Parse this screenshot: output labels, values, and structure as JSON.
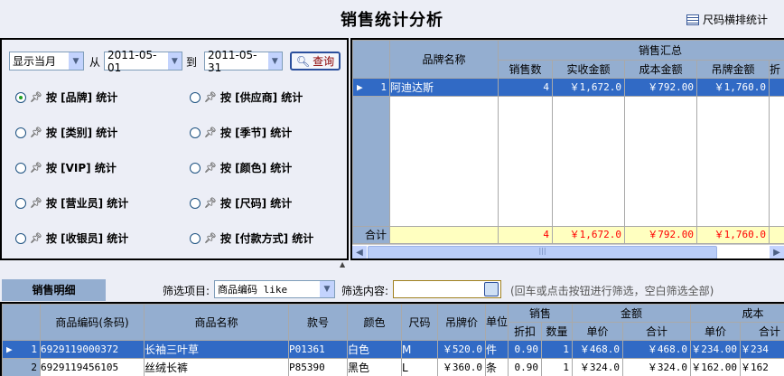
{
  "title": "销售统计分析",
  "size_stats_button": "尺码横排统计",
  "query": {
    "period": "显示当月",
    "from_label": "从",
    "from_date": "2011-05-01",
    "to_label": "到",
    "to_date": "2011-05-31",
    "query_button": "查询"
  },
  "stat_options": [
    {
      "label": "按 [品牌] 统计",
      "checked": true
    },
    {
      "label": "按 [供应商] 统计",
      "checked": false
    },
    {
      "label": "按 [类别] 统计",
      "checked": false
    },
    {
      "label": "按 [季节] 统计",
      "checked": false
    },
    {
      "label": "按 [VIP] 统计",
      "checked": false
    },
    {
      "label": "按 [颜色] 统计",
      "checked": false
    },
    {
      "label": "按 [营业员] 统计",
      "checked": false
    },
    {
      "label": "按 [尺码] 统计",
      "checked": false
    },
    {
      "label": "按 [收银员] 统计",
      "checked": false
    },
    {
      "label": "按 [付款方式] 统计",
      "checked": false
    }
  ],
  "summary_grid": {
    "col_brand": "品牌名称",
    "group_sales": "销售汇总",
    "cols": [
      "销售数",
      "实收金额",
      "成本金额",
      "吊牌金额",
      "折"
    ],
    "rows": [
      {
        "no": "1",
        "brand": "阿迪达斯",
        "qty": "4",
        "actual": "￥1,672.0",
        "cost": "￥792.00",
        "tag": "￥1,760.0"
      }
    ],
    "total": {
      "label": "合计",
      "qty": "4",
      "actual": "￥1,672.0",
      "cost": "￥792.00",
      "tag": "￥1,760.0"
    }
  },
  "detail_tab": "销售明细",
  "filter": {
    "item_label": "筛选项目:",
    "item_value": "商品编码 like",
    "content_label": "筛选内容:",
    "content_value": "",
    "hint": "(回车或点击按钮进行筛选，空白筛选全部)"
  },
  "detail_grid": {
    "headers": {
      "code": "商品编码(条码)",
      "name": "商品名称",
      "style": "款号",
      "color": "颜色",
      "size": "尺码",
      "tag_price": "吊牌价",
      "unit": "单位",
      "sales": "销售",
      "discount": "折扣",
      "qty": "数量",
      "amount": "金额",
      "price": "单价",
      "total": "合计",
      "cost": "成本",
      "cost_price": "单价",
      "cost_total": "合计"
    },
    "rows": [
      {
        "no": "1",
        "code": "6929119000372",
        "name": "长袖三叶草",
        "style": "P01361",
        "color": "白色",
        "size": "M",
        "tag_price": "￥520.0",
        "unit": "件",
        "discount": "0.90",
        "qty": "1",
        "price": "￥468.0",
        "total": "￥468.0",
        "cost_price": "￥234.00",
        "cost_total": "￥234"
      },
      {
        "no": "2",
        "code": "6929119456105",
        "name": "丝绒长裤",
        "style": "P85390",
        "color": "黑色",
        "size": "L",
        "tag_price": "￥360.0",
        "unit": "条",
        "discount": "0.90",
        "qty": "1",
        "price": "￥324.0",
        "total": "￥324.0",
        "cost_price": "￥162.00",
        "cost_total": "￥162"
      }
    ]
  },
  "colors": {
    "header": "#94AED0",
    "selected": "#316AC5",
    "total_row": "#FFFFC0",
    "total_text": "#FF0000"
  }
}
